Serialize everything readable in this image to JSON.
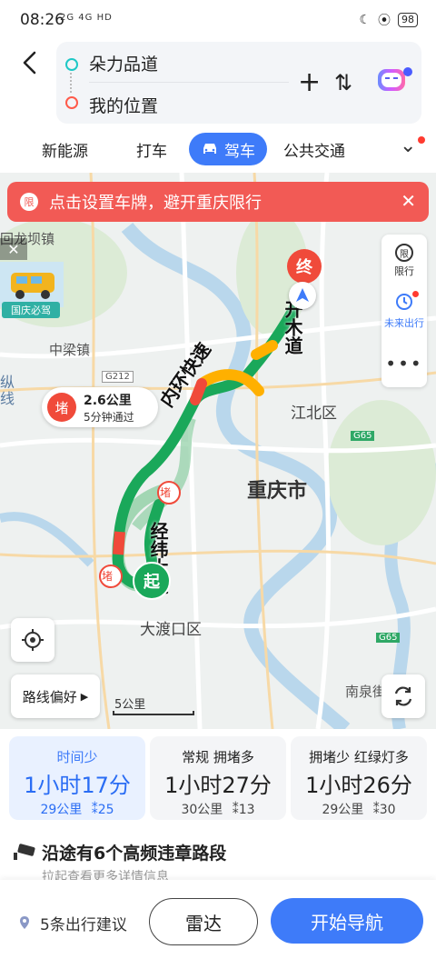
{
  "status_bar": {
    "time": "08:26",
    "network": "2G 4G HD",
    "battery": "98"
  },
  "route_input": {
    "destination": "朵力品道",
    "origin": "我的位置"
  },
  "tabs": {
    "items": [
      "新能源",
      "打车",
      "公共交通"
    ],
    "active": "驾车"
  },
  "notice": {
    "badge": "限",
    "text": "点击设置车牌，避开重庆限行"
  },
  "side_panel": {
    "restriction": "限行",
    "restriction_icon": "限",
    "future": "未来出行"
  },
  "promo": {
    "label": "国庆必驾"
  },
  "map": {
    "labels": {
      "town1": "回龙坝镇",
      "town2": "中梁镇",
      "district1": "江北区",
      "city": "重庆市",
      "district2": "大渡口区",
      "town3": "南泉街",
      "road_g212": "G212",
      "road_g65a": "G65",
      "road_g65b": "G65",
      "edge_left": "纵线"
    },
    "markers": {
      "start": "起",
      "end": "终",
      "jam": "堵"
    },
    "route_road_labels": [
      "开木道",
      "内环快速",
      "经纬大道"
    ]
  },
  "jam_card": {
    "badge": "堵",
    "distance": "2.6公里",
    "time": "5分钟通过"
  },
  "controls": {
    "route_pref": "路线偏好",
    "scale": "5公里"
  },
  "routes": [
    {
      "tag": "时间少",
      "duration": "1小时17分",
      "distance": "29公里",
      "lights": "25",
      "selected": true
    },
    {
      "tag": "常规 拥堵多",
      "duration": "1小时27分",
      "distance": "30公里",
      "lights": "13",
      "selected": false
    },
    {
      "tag": "拥堵少 红绿灯多",
      "duration": "1小时26分",
      "distance": "29公里",
      "lights": "30",
      "selected": false
    }
  ],
  "violation": {
    "title": "沿途有6个高频违章路段",
    "subtitle": "拉起查看更多详情信息"
  },
  "bottom": {
    "tip": "5条出行建议",
    "radar": "雷达",
    "navigate": "开始导航"
  },
  "colors": {
    "accent": "#3e7bf9",
    "jam": "#f04a3a",
    "route_green": "#1aa85a",
    "notice_bg": "#f25a55"
  }
}
